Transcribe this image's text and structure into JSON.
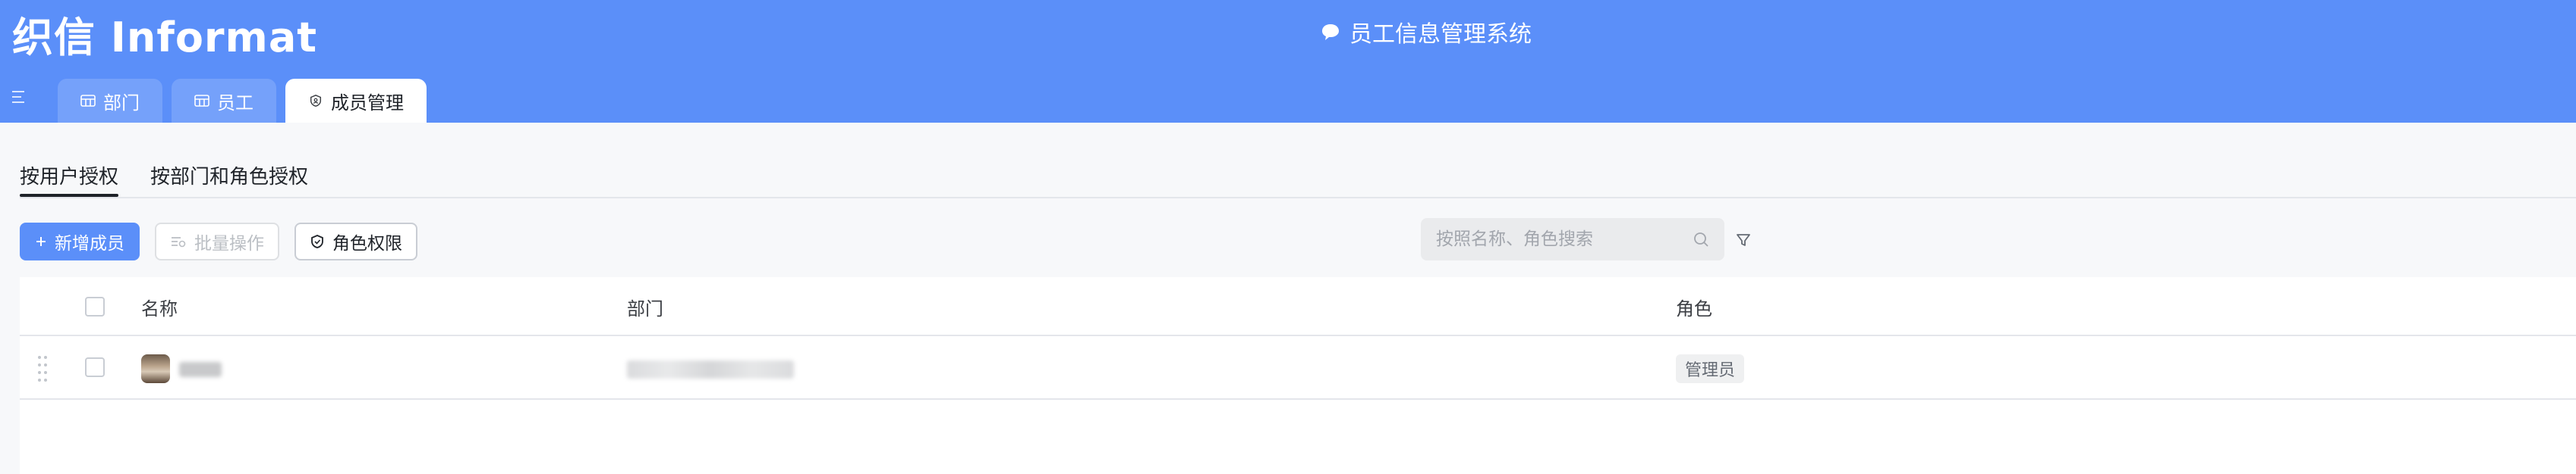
{
  "header": {
    "logo_text": "织信 Informat",
    "app_title": "员工信息管理系统",
    "background": "#5b8ff9"
  },
  "tabs": [
    {
      "label": "部门",
      "icon": "table-icon",
      "active": false
    },
    {
      "label": "员工",
      "icon": "table-icon",
      "active": false
    },
    {
      "label": "成员管理",
      "icon": "shield-icon",
      "active": true
    }
  ],
  "subtabs": [
    {
      "label": "按用户授权",
      "active": true
    },
    {
      "label": "按部门和角色授权",
      "active": false
    }
  ],
  "toolbar": {
    "add_label": "新增成员",
    "batch_label": "批量操作",
    "roles_label": "角色权限"
  },
  "search": {
    "placeholder": "按照名称、角色搜索",
    "value": ""
  },
  "table": {
    "columns": [
      "名称",
      "部门",
      "角色"
    ],
    "rows": [
      {
        "name": "",
        "department": "",
        "role": "管理员"
      }
    ]
  }
}
